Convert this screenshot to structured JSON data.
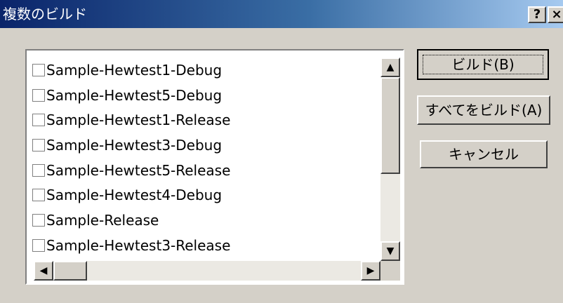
{
  "window": {
    "title": "複数のビルド",
    "help_button": "?",
    "close_button": "×"
  },
  "list": {
    "items": [
      {
        "label": "Sample-Hewtest1-Debug",
        "checked": false
      },
      {
        "label": "Sample-Hewtest5-Debug",
        "checked": false
      },
      {
        "label": "Sample-Hewtest1-Release",
        "checked": false
      },
      {
        "label": "Sample-Hewtest3-Debug",
        "checked": false
      },
      {
        "label": "Sample-Hewtest5-Release",
        "checked": false
      },
      {
        "label": "Sample-Hewtest4-Debug",
        "checked": false
      },
      {
        "label": "Sample-Release",
        "checked": false
      },
      {
        "label": "Sample-Hewtest3-Release",
        "checked": false
      }
    ]
  },
  "scroll": {
    "up": "▲",
    "down": "▼",
    "left": "◀",
    "right": "▶"
  },
  "buttons": {
    "build": "ビルド(B)",
    "build_all": "すべてをビルド(A)",
    "cancel": "キャンセル"
  }
}
